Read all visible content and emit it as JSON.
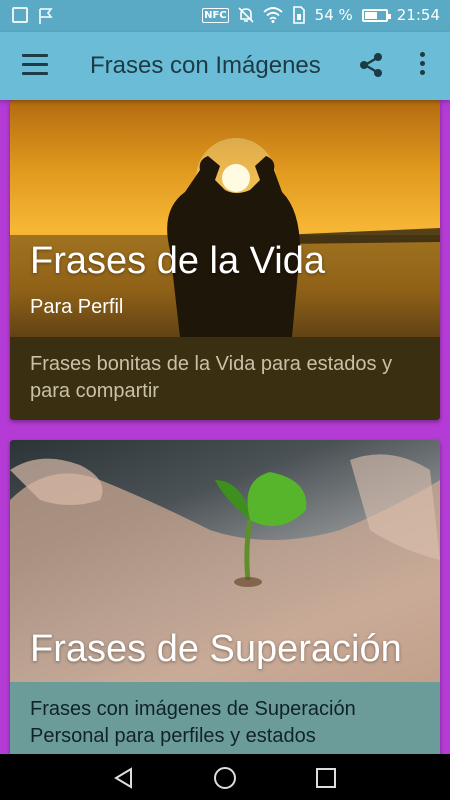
{
  "status_bar": {
    "battery_text": "54 %",
    "battery_level": 0.54,
    "time": "21:54",
    "nfc_label": "NFC",
    "icons": [
      "gallery-icon",
      "flag-icon",
      "nfc-icon",
      "mute-icon",
      "wifi-icon",
      "sim-icon",
      "battery-icon"
    ]
  },
  "app_bar": {
    "title": "Frases con Imágenes",
    "icons": [
      "menu-icon",
      "share-icon",
      "more-vert-icon"
    ]
  },
  "cards": [
    {
      "title": "Frases de la Vida",
      "subtitle": "Para Perfil",
      "description": "Frases bonitas de la Vida para estados y para compartir"
    },
    {
      "title": "Frases de Superación",
      "description": "Frases con imágenes de Superación Personal para perfiles y estados"
    }
  ],
  "nav_bar": {
    "icons": [
      "back-icon",
      "home-icon",
      "recents-icon"
    ]
  },
  "colors": {
    "status_bar": "#5aa9c5",
    "app_bar": "#6bbcd6",
    "background": "#b53bd6",
    "card1_footer": "#3a3011",
    "card2_footer": "#6c9c99"
  }
}
